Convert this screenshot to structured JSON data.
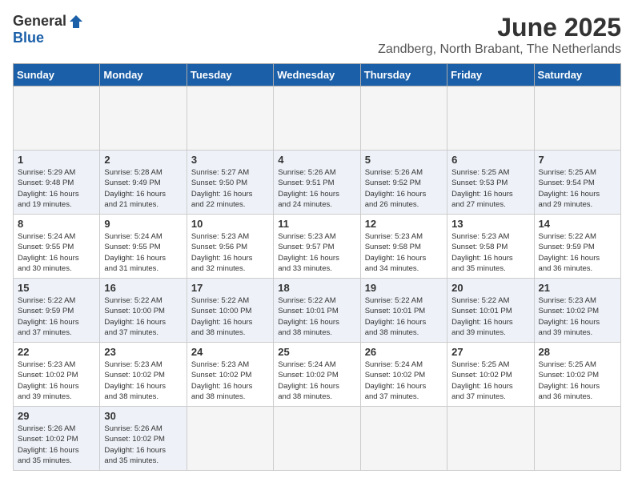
{
  "header": {
    "logo_general": "General",
    "logo_blue": "Blue",
    "month_title": "June 2025",
    "location": "Zandberg, North Brabant, The Netherlands"
  },
  "calendar": {
    "days_of_week": [
      "Sunday",
      "Monday",
      "Tuesday",
      "Wednesday",
      "Thursday",
      "Friday",
      "Saturday"
    ],
    "weeks": [
      [
        {
          "day": "",
          "info": ""
        },
        {
          "day": "",
          "info": ""
        },
        {
          "day": "",
          "info": ""
        },
        {
          "day": "",
          "info": ""
        },
        {
          "day": "",
          "info": ""
        },
        {
          "day": "",
          "info": ""
        },
        {
          "day": "",
          "info": ""
        }
      ],
      [
        {
          "day": "1",
          "info": "Sunrise: 5:29 AM\nSunset: 9:48 PM\nDaylight: 16 hours\nand 19 minutes."
        },
        {
          "day": "2",
          "info": "Sunrise: 5:28 AM\nSunset: 9:49 PM\nDaylight: 16 hours\nand 21 minutes."
        },
        {
          "day": "3",
          "info": "Sunrise: 5:27 AM\nSunset: 9:50 PM\nDaylight: 16 hours\nand 22 minutes."
        },
        {
          "day": "4",
          "info": "Sunrise: 5:26 AM\nSunset: 9:51 PM\nDaylight: 16 hours\nand 24 minutes."
        },
        {
          "day": "5",
          "info": "Sunrise: 5:26 AM\nSunset: 9:52 PM\nDaylight: 16 hours\nand 26 minutes."
        },
        {
          "day": "6",
          "info": "Sunrise: 5:25 AM\nSunset: 9:53 PM\nDaylight: 16 hours\nand 27 minutes."
        },
        {
          "day": "7",
          "info": "Sunrise: 5:25 AM\nSunset: 9:54 PM\nDaylight: 16 hours\nand 29 minutes."
        }
      ],
      [
        {
          "day": "8",
          "info": "Sunrise: 5:24 AM\nSunset: 9:55 PM\nDaylight: 16 hours\nand 30 minutes."
        },
        {
          "day": "9",
          "info": "Sunrise: 5:24 AM\nSunset: 9:55 PM\nDaylight: 16 hours\nand 31 minutes."
        },
        {
          "day": "10",
          "info": "Sunrise: 5:23 AM\nSunset: 9:56 PM\nDaylight: 16 hours\nand 32 minutes."
        },
        {
          "day": "11",
          "info": "Sunrise: 5:23 AM\nSunset: 9:57 PM\nDaylight: 16 hours\nand 33 minutes."
        },
        {
          "day": "12",
          "info": "Sunrise: 5:23 AM\nSunset: 9:58 PM\nDaylight: 16 hours\nand 34 minutes."
        },
        {
          "day": "13",
          "info": "Sunrise: 5:23 AM\nSunset: 9:58 PM\nDaylight: 16 hours\nand 35 minutes."
        },
        {
          "day": "14",
          "info": "Sunrise: 5:22 AM\nSunset: 9:59 PM\nDaylight: 16 hours\nand 36 minutes."
        }
      ],
      [
        {
          "day": "15",
          "info": "Sunrise: 5:22 AM\nSunset: 9:59 PM\nDaylight: 16 hours\nand 37 minutes."
        },
        {
          "day": "16",
          "info": "Sunrise: 5:22 AM\nSunset: 10:00 PM\nDaylight: 16 hours\nand 37 minutes."
        },
        {
          "day": "17",
          "info": "Sunrise: 5:22 AM\nSunset: 10:00 PM\nDaylight: 16 hours\nand 38 minutes."
        },
        {
          "day": "18",
          "info": "Sunrise: 5:22 AM\nSunset: 10:01 PM\nDaylight: 16 hours\nand 38 minutes."
        },
        {
          "day": "19",
          "info": "Sunrise: 5:22 AM\nSunset: 10:01 PM\nDaylight: 16 hours\nand 38 minutes."
        },
        {
          "day": "20",
          "info": "Sunrise: 5:22 AM\nSunset: 10:01 PM\nDaylight: 16 hours\nand 39 minutes."
        },
        {
          "day": "21",
          "info": "Sunrise: 5:23 AM\nSunset: 10:02 PM\nDaylight: 16 hours\nand 39 minutes."
        }
      ],
      [
        {
          "day": "22",
          "info": "Sunrise: 5:23 AM\nSunset: 10:02 PM\nDaylight: 16 hours\nand 39 minutes."
        },
        {
          "day": "23",
          "info": "Sunrise: 5:23 AM\nSunset: 10:02 PM\nDaylight: 16 hours\nand 38 minutes."
        },
        {
          "day": "24",
          "info": "Sunrise: 5:23 AM\nSunset: 10:02 PM\nDaylight: 16 hours\nand 38 minutes."
        },
        {
          "day": "25",
          "info": "Sunrise: 5:24 AM\nSunset: 10:02 PM\nDaylight: 16 hours\nand 38 minutes."
        },
        {
          "day": "26",
          "info": "Sunrise: 5:24 AM\nSunset: 10:02 PM\nDaylight: 16 hours\nand 37 minutes."
        },
        {
          "day": "27",
          "info": "Sunrise: 5:25 AM\nSunset: 10:02 PM\nDaylight: 16 hours\nand 37 minutes."
        },
        {
          "day": "28",
          "info": "Sunrise: 5:25 AM\nSunset: 10:02 PM\nDaylight: 16 hours\nand 36 minutes."
        }
      ],
      [
        {
          "day": "29",
          "info": "Sunrise: 5:26 AM\nSunset: 10:02 PM\nDaylight: 16 hours\nand 35 minutes."
        },
        {
          "day": "30",
          "info": "Sunrise: 5:26 AM\nSunset: 10:02 PM\nDaylight: 16 hours\nand 35 minutes."
        },
        {
          "day": "",
          "info": ""
        },
        {
          "day": "",
          "info": ""
        },
        {
          "day": "",
          "info": ""
        },
        {
          "day": "",
          "info": ""
        },
        {
          "day": "",
          "info": ""
        }
      ]
    ]
  }
}
